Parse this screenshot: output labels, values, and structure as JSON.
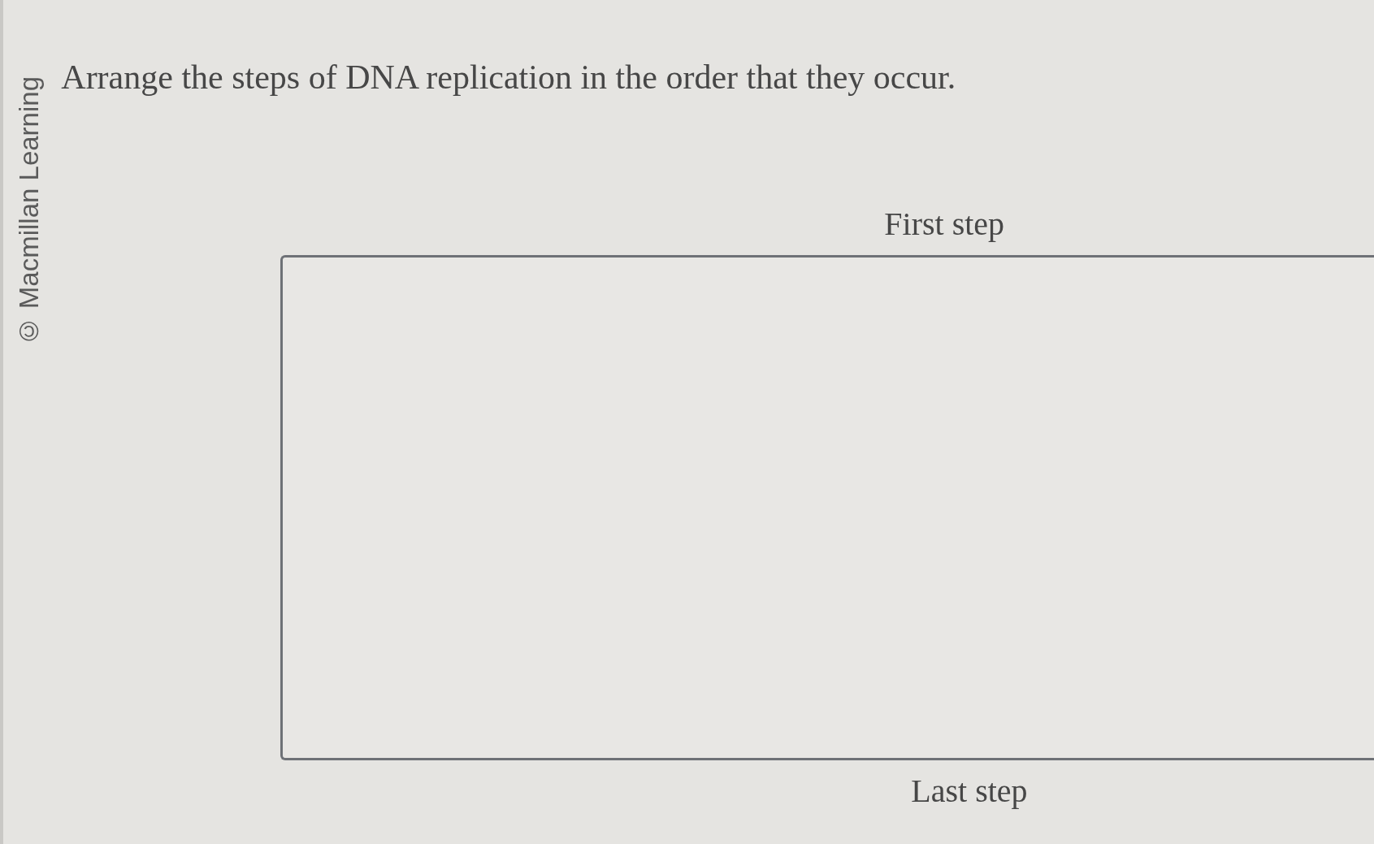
{
  "copyright": "© Macmillan Learning",
  "question": "Arrange the steps of DNA replication in the order that they occur.",
  "ordering": {
    "top_label": "First step",
    "bottom_label": "Last step"
  }
}
